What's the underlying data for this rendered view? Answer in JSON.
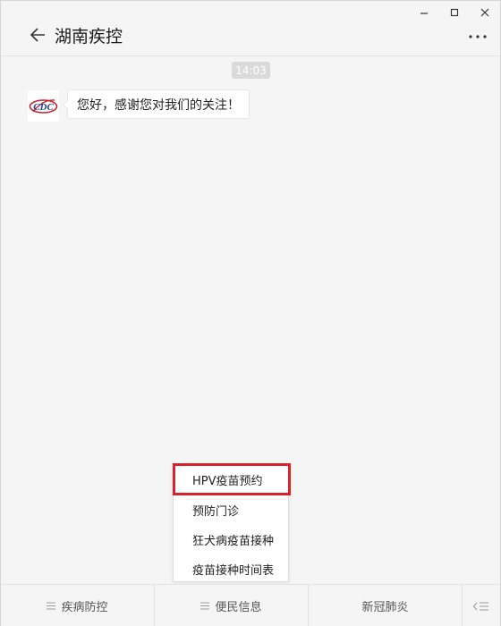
{
  "window": {
    "controls": [
      "minimize",
      "maximize",
      "close"
    ]
  },
  "header": {
    "title": "湖南疾控",
    "back_icon": "arrow-left-icon",
    "more_icon": "more-dots-icon"
  },
  "chat": {
    "time": "14:03",
    "messages": [
      {
        "avatar_icon": "cdc-logo-icon",
        "text": "您好，感谢您对我们的关注！"
      }
    ]
  },
  "popup_menu": {
    "items": [
      {
        "label": "HPV疫苗预约",
        "highlighted": true
      },
      {
        "label": "预防门诊"
      },
      {
        "label": "狂犬病疫苗接种"
      },
      {
        "label": "疫苗接种时间表"
      }
    ]
  },
  "footer": {
    "tabs": [
      {
        "label": "疾病防控",
        "has_menu_icon": true
      },
      {
        "label": "便民信息",
        "has_menu_icon": true
      },
      {
        "label": "新冠肺炎",
        "has_menu_icon": false
      }
    ],
    "keyboard_icon": "keyboard-toggle-icon"
  },
  "colors": {
    "highlight": "#d8232a",
    "background": "#f5f5f5",
    "time_badge": "#dadada"
  }
}
